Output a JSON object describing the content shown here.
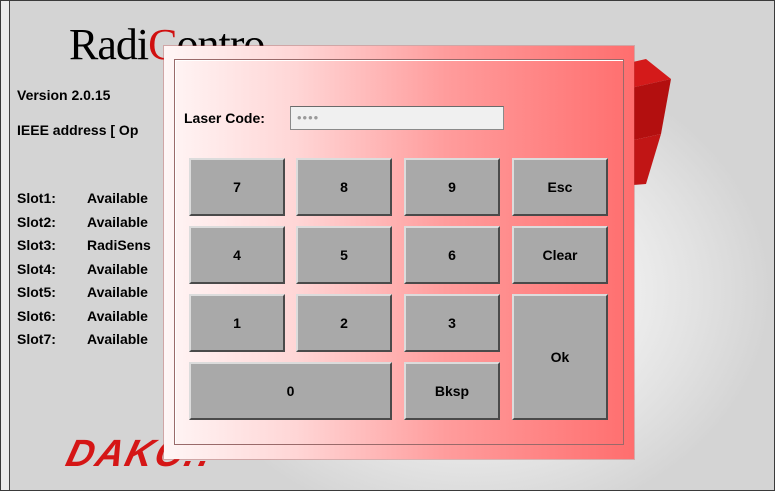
{
  "app": {
    "title_part1": "Radi",
    "title_part2": "C",
    "title_part3": "ontro",
    "version": "Version 2.0.15",
    "ieee": "IEEE address [ Op",
    "logo_text": "DAKC!!",
    "slots": [
      {
        "label": "Slot1:",
        "value": "Available"
      },
      {
        "label": "Slot2:",
        "value": "Available"
      },
      {
        "label": "Slot3:",
        "value": "RadiSens"
      },
      {
        "label": "Slot4:",
        "value": "Available"
      },
      {
        "label": "Slot5:",
        "value": "Available"
      },
      {
        "label": "Slot6:",
        "value": "Available"
      },
      {
        "label": "Slot7:",
        "value": "Available"
      }
    ]
  },
  "dialog": {
    "code_label": "Laser Code:",
    "code_value": "••••",
    "keys": {
      "k7": "7",
      "k8": "8",
      "k9": "9",
      "esc": "Esc",
      "k4": "4",
      "k5": "5",
      "k6": "6",
      "clear": "Clear",
      "k1": "1",
      "k2": "2",
      "k3": "3",
      "ok": "Ok",
      "k0": "0",
      "bksp": "Bksp"
    }
  },
  "colors": {
    "accent_red": "#d01010",
    "dialog_gradient_end": "#ff6e6e",
    "key_face": "#a9a9a9"
  }
}
